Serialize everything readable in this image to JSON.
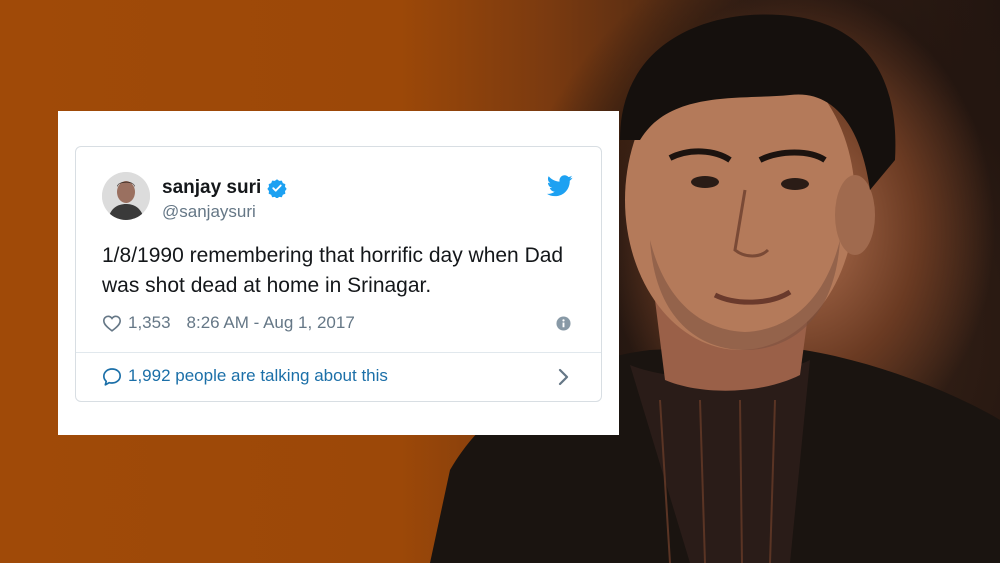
{
  "tweet": {
    "author_name": "sanjay suri",
    "author_handle": "@sanjaysuri",
    "text": "1/8/1990 remembering that horrific day when Dad was shot dead at home in Srinagar.",
    "likes": "1,353",
    "timestamp": "8:26 AM - Aug 1, 2017",
    "conversation": "1,992 people are talking about this"
  },
  "icons": {
    "verified": "verified-badge-icon",
    "brand": "twitter-bird-icon",
    "like": "heart-icon",
    "info": "info-icon",
    "reply": "speech-bubble-icon",
    "more": "chevron-right-icon"
  },
  "colors": {
    "background": "#9a4a0a",
    "twitter_blue": "#1da1f2",
    "link_blue": "#1b6fa8",
    "text_primary": "#14171a",
    "text_secondary": "#657786"
  }
}
